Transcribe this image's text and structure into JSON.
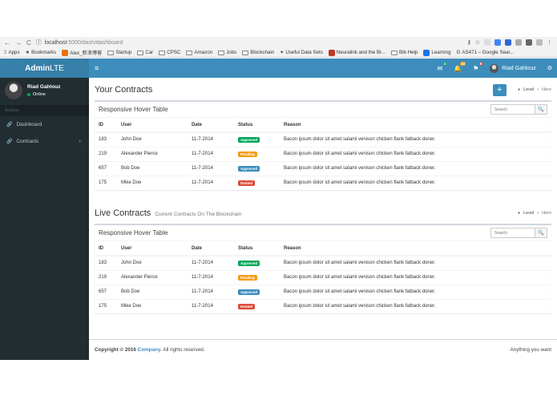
{
  "browser": {
    "url_host": "localhost",
    "url_path": ":5000/dash/dashboard",
    "bookmarks": [
      "Apps",
      "Bookmarks",
      "Alex_新浪博客",
      "Startup",
      "Car",
      "CPSC",
      "Amazon",
      "Jobs",
      "Blockchain",
      "Useful Data Sets",
      "Neuralink and the Br...",
      "Bib Help",
      "Learning",
      "AS471 – Google Sear..."
    ]
  },
  "header": {
    "logo_bold": "Admin",
    "logo_light": "LTE",
    "badges": {
      "mail": "4",
      "bell": "10",
      "flag": "9"
    },
    "user_name": "Riad Gahlouz"
  },
  "sidebar": {
    "user_name": "Riad Gahlouz",
    "status": "Online",
    "section_header": "Actions",
    "items": [
      {
        "label": "Dashboard"
      },
      {
        "label": "Contracts"
      }
    ]
  },
  "contracts": {
    "title": "Your Contracts",
    "crumb_level": "Level",
    "crumb_here": "Here",
    "add_label": "+",
    "box_title": "Responsive Hover Table",
    "search_placeholder": "Search"
  },
  "live": {
    "title": "Live Contracts",
    "subtitle": "Current Contracts On The Blockchain",
    "crumb_level": "Level",
    "crumb_here": "Here",
    "box_title": "Responsive Hover Table",
    "search_placeholder": "Search"
  },
  "table": {
    "headers": [
      "ID",
      "User",
      "Date",
      "Status",
      "Reason"
    ],
    "rows": [
      {
        "id": "183",
        "user": "John Doe",
        "date": "11-7-2014",
        "status": "Approved",
        "color": "#00a65a",
        "reason": "Bacon ipsum dolor sit amet salami venison chicken flank fatback doner."
      },
      {
        "id": "219",
        "user": "Alexander Pierce",
        "date": "11-7-2014",
        "status": "Pending",
        "color": "#f39c12",
        "reason": "Bacon ipsum dolor sit amet salami venison chicken flank fatback doner."
      },
      {
        "id": "657",
        "user": "Bob Doe",
        "date": "11-7-2014",
        "status": "Approved",
        "color": "#3c8dbc",
        "reason": "Bacon ipsum dolor sit amet salami venison chicken flank fatback doner."
      },
      {
        "id": "175",
        "user": "Mike Doe",
        "date": "11-7-2014",
        "status": "Denied",
        "color": "#dd4b39",
        "reason": "Bacon ipsum dolor sit amet salami venison chicken flank fatback doner."
      }
    ]
  },
  "footer": {
    "copyright": "Copyright © 2016",
    "company": "Company.",
    "rights": "All rights reserved.",
    "right_text": "Anything you want"
  }
}
